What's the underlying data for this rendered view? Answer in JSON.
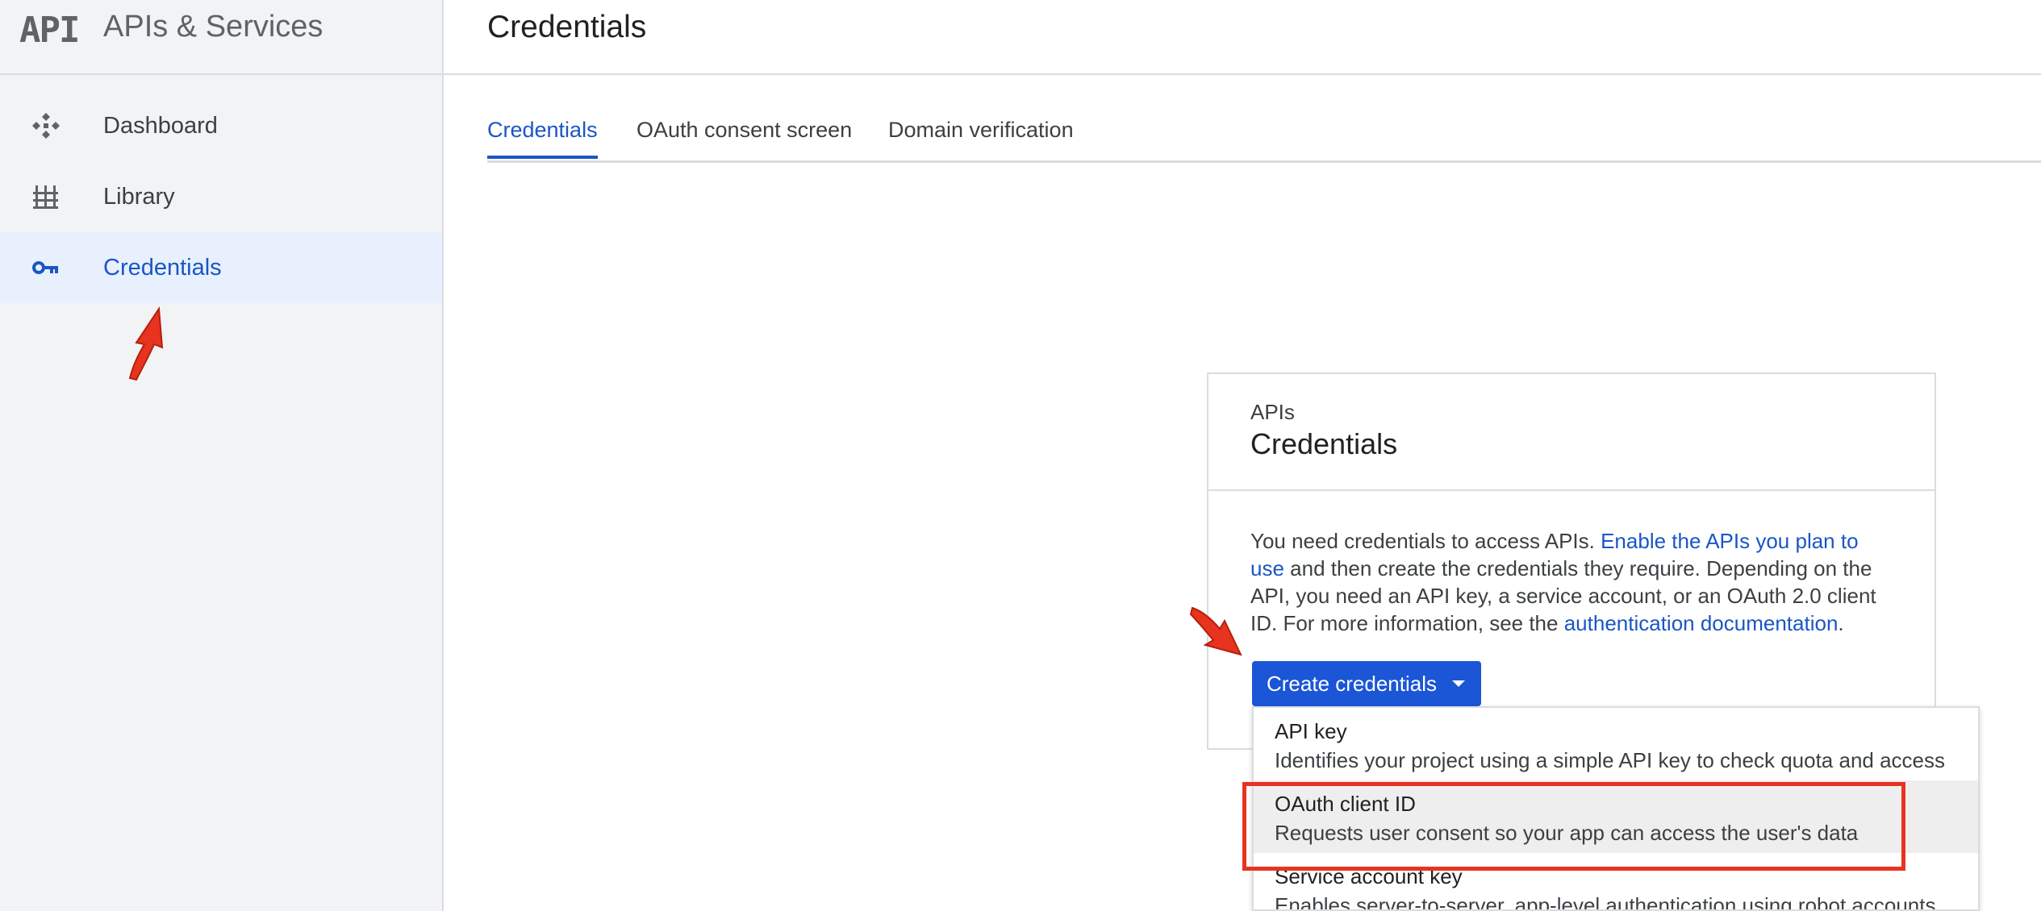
{
  "brand": {
    "logo_text": "API",
    "title": "APIs & Services"
  },
  "sidebar": {
    "items": [
      {
        "label": "Dashboard",
        "icon": "dashboard-icon",
        "active": false
      },
      {
        "label": "Library",
        "icon": "library-icon",
        "active": false
      },
      {
        "label": "Credentials",
        "icon": "key-icon",
        "active": true
      }
    ]
  },
  "header": {
    "title": "Credentials"
  },
  "tabs": [
    {
      "label": "Credentials",
      "active": true
    },
    {
      "label": "OAuth consent screen",
      "active": false
    },
    {
      "label": "Domain verification",
      "active": false
    }
  ],
  "card": {
    "eyebrow": "APIs",
    "title": "Credentials",
    "body": {
      "text_1": "You need credentials to access APIs. ",
      "link_1": "Enable the APIs you plan to use",
      "text_2": " and then create the credentials they require. Depending on the API, you need an API key, a service account, or an OAuth 2.0 client ID. For more information, see the ",
      "link_2": "authentication documentation",
      "text_3": "."
    },
    "button_label": "Create credentials"
  },
  "menu": {
    "items": [
      {
        "title": "API key",
        "description": "Identifies your project using a simple API key to check quota and access"
      },
      {
        "title": "OAuth client ID",
        "description": "Requests user consent so your app can access the user's data"
      },
      {
        "title": "Service account key",
        "description": "Enables server-to-server, app-level authentication using robot accounts"
      }
    ]
  },
  "colors": {
    "accent": "#1a56c4",
    "button": "#1a56d6",
    "sidebar_bg": "#f1f3f4",
    "active_bg": "#e8f0fe",
    "annotation": "#e8331f"
  }
}
